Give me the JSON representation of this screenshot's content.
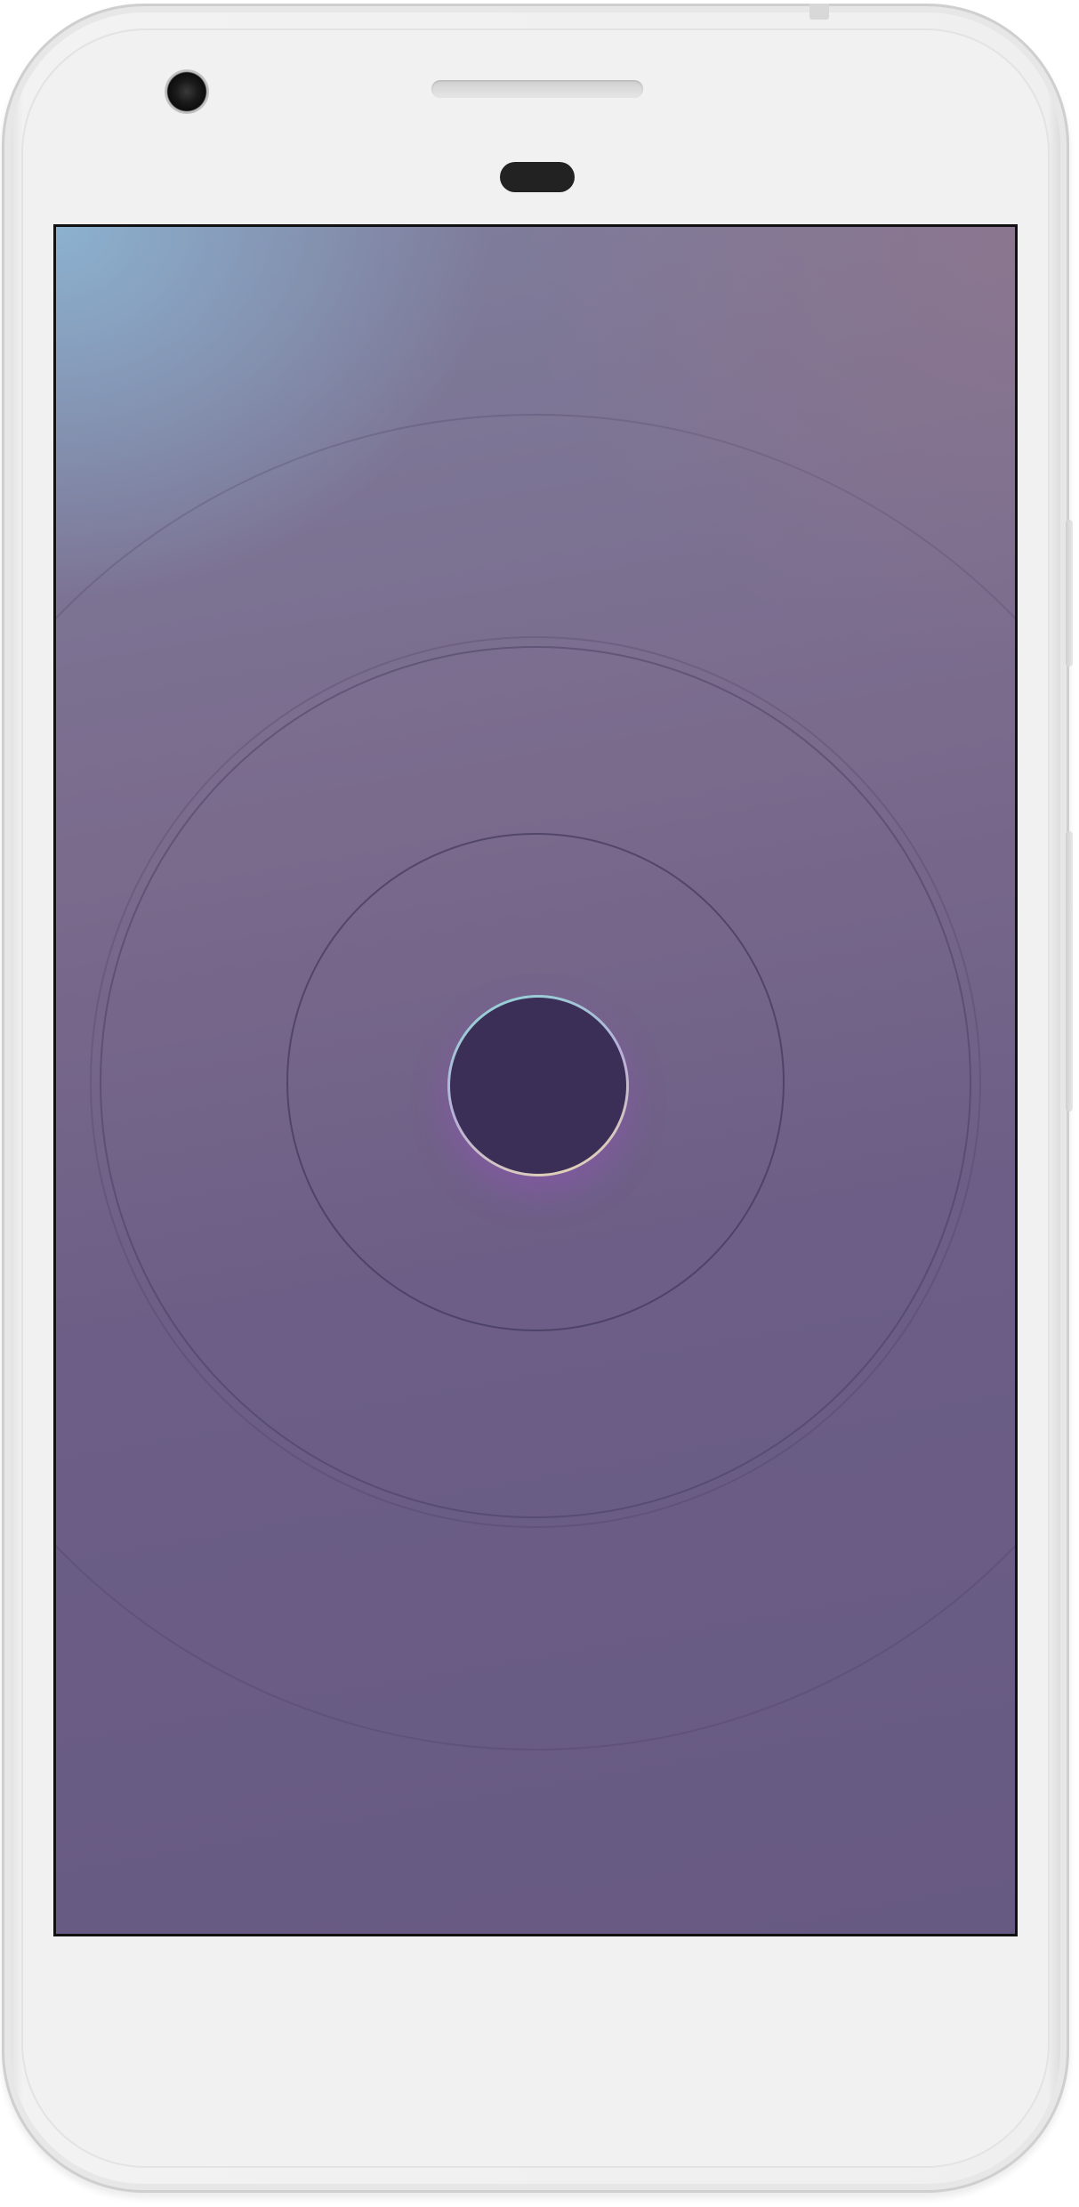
{
  "device": {
    "frame_color": "#efefef",
    "sensor_color": "#222222"
  },
  "screen": {
    "background_colors": [
      "#8cb4d2",
      "#7a6a8c",
      "#675a82"
    ],
    "ring_color": "#3e3458",
    "center_button": {
      "icon": "circle-button-icon",
      "fill_color": "#3b2f57",
      "rim_colors": [
        "#8fd8d6",
        "#e9d8b0"
      ]
    }
  }
}
